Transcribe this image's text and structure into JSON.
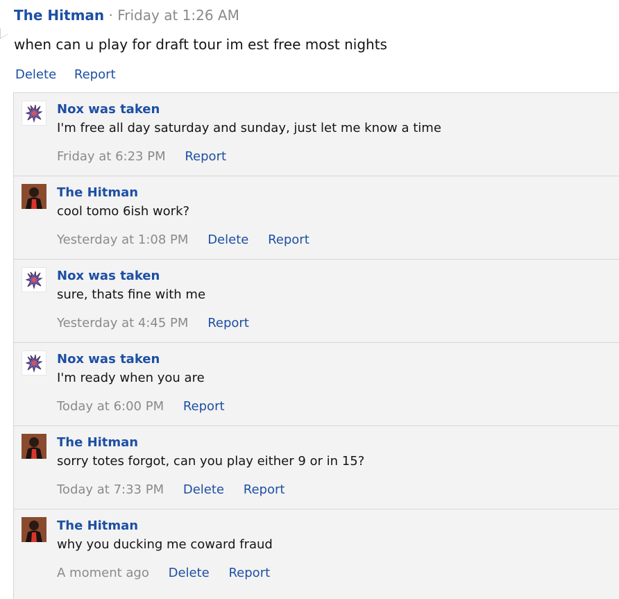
{
  "post": {
    "author": "The Hitman",
    "separator": "·",
    "time": "Friday at 1:26 AM",
    "text": "when can u play for draft tour im est free most nights",
    "actions": {
      "delete": "Delete",
      "report": "Report"
    }
  },
  "comments": [
    {
      "author": "Nox was taken",
      "avatar": "pokemon-sprite-avatar",
      "text": "I'm free all day saturday and sunday, just let me know a time",
      "time": "Friday at 6:23 PM",
      "delete": null,
      "report": "Report"
    },
    {
      "author": "The Hitman",
      "avatar": "user-photo-avatar",
      "text": "cool tomo 6ish work?",
      "time": "Yesterday at 1:08 PM",
      "delete": "Delete",
      "report": "Report"
    },
    {
      "author": "Nox was taken",
      "avatar": "pokemon-sprite-avatar",
      "text": "sure, thats fine with me",
      "time": "Yesterday at 4:45 PM",
      "delete": null,
      "report": "Report"
    },
    {
      "author": "Nox was taken",
      "avatar": "pokemon-sprite-avatar",
      "text": "I'm ready when you are",
      "time": "Today at 6:00 PM",
      "delete": null,
      "report": "Report"
    },
    {
      "author": "The Hitman",
      "avatar": "user-photo-avatar",
      "text": "sorry totes forgot, can you play either 9 or in 15?",
      "time": "Today at 7:33 PM",
      "delete": "Delete",
      "report": "Report"
    },
    {
      "author": "The Hitman",
      "avatar": "user-photo-avatar",
      "text": "why you ducking me coward fraud",
      "time": "A moment ago",
      "delete": "Delete",
      "report": "Report"
    }
  ],
  "colors": {
    "link": "#1d4fa3",
    "muted": "#8a8a8a",
    "comment_bg": "#f3f3f3"
  }
}
